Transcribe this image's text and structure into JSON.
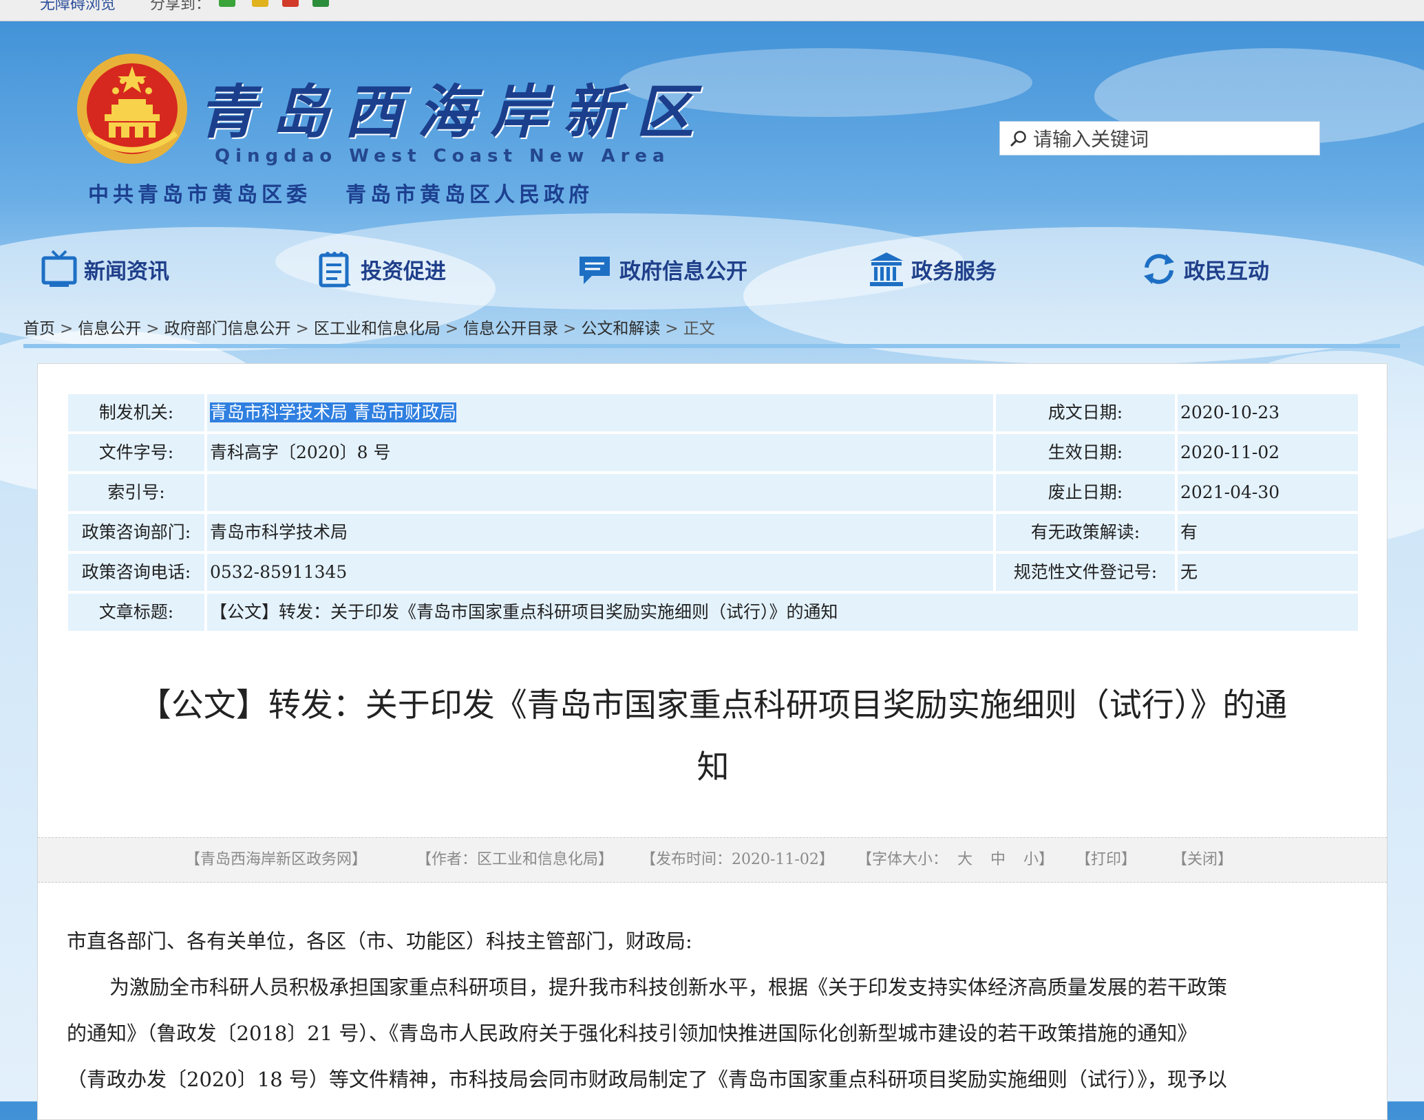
{
  "topbar": {
    "accessibility": "无障碍浏览",
    "share_label": "分享到："
  },
  "header": {
    "site_title": "青岛西海岸新区",
    "site_title_en": "Qingdao West Coast New Area",
    "org1": "中共青岛市黄岛区委",
    "org2": "青岛市黄岛区人民政府",
    "search_placeholder": "请输入关键词"
  },
  "nav": [
    {
      "label": "新闻资讯",
      "icon": "tv-icon"
    },
    {
      "label": "投资促进",
      "icon": "document-list-icon"
    },
    {
      "label": "政府信息公开",
      "icon": "speech-bubble-icon"
    },
    {
      "label": "政务服务",
      "icon": "government-building-icon"
    },
    {
      "label": "政民互动",
      "icon": "refresh-arrows-icon"
    }
  ],
  "breadcrumb": [
    "首页",
    "信息公开",
    "政府部门信息公开",
    "区工业和信息化局",
    "信息公开目录",
    "公文和解读",
    "正文"
  ],
  "meta": {
    "issuer_label": "制发机关:",
    "issuer": "青岛市科学技术局 青岛市财政局",
    "doc_no_label": "文件字号:",
    "doc_no": "青科高字〔2020〕8 号",
    "index_label": "索引号:",
    "index": "",
    "consult_dept_label": "政策咨询部门:",
    "consult_dept": "青岛市科学技术局",
    "consult_phone_label": "政策咨询电话:",
    "consult_phone": "0532-85911345",
    "article_title_label": "文章标题:",
    "article_title": "【公文】转发：关于印发《青岛市国家重点科研项目奖励实施细则（试行）》的通知",
    "date_written_label": "成文日期:",
    "date_written": "2020-10-23",
    "date_effective_label": "生效日期:",
    "date_effective": "2020-11-02",
    "date_expire_label": "废止日期:",
    "date_expire": "2021-04-30",
    "interpretation_label": "有无政策解读:",
    "interpretation": "有",
    "reg_no_label": "规范性文件登记号:",
    "reg_no": "无"
  },
  "doc_title_line1": "【公文】转发：关于印发《青岛市国家重点科研项目奖励实施细则（试行）》的通",
  "doc_title_line2": "知",
  "infobar": {
    "source": "【青岛西海岸新区政务网】",
    "author": "【作者：区工业和信息化局】",
    "pubtime": "【发布时间：2020-11-02】",
    "font_size_label": "【字体大小：",
    "size_large": "大",
    "size_medium": "中",
    "size_small": "小",
    "font_size_end": "】",
    "print": "【打印】",
    "close": "【关闭】"
  },
  "body": {
    "salutation": "市直各部门、各有关单位，各区（市、功能区）科技主管部门，财政局:",
    "para1_line1": "为激励全市科研人员积极承担国家重点科研项目，提升我市科技创新水平，根据《关于印发支持实体经济高质量发展的若干政策",
    "para1_line2": "的通知》（鲁政发〔2018〕21 号）、《青岛市人民政府关于强化科技引领加快推进国际化创新型城市建设的若干政策措施的通知》",
    "para1_line3": "（青政办发〔2020〕18 号）等文件精神，市科技局会同市财政局制定了《青岛市国家重点科研项目奖励实施细则（试行）》，现予以"
  },
  "colors": {
    "nav_text": "#1f3f8a",
    "meta_bg": "#e4f2fc",
    "selection": "#2f7fe0"
  }
}
